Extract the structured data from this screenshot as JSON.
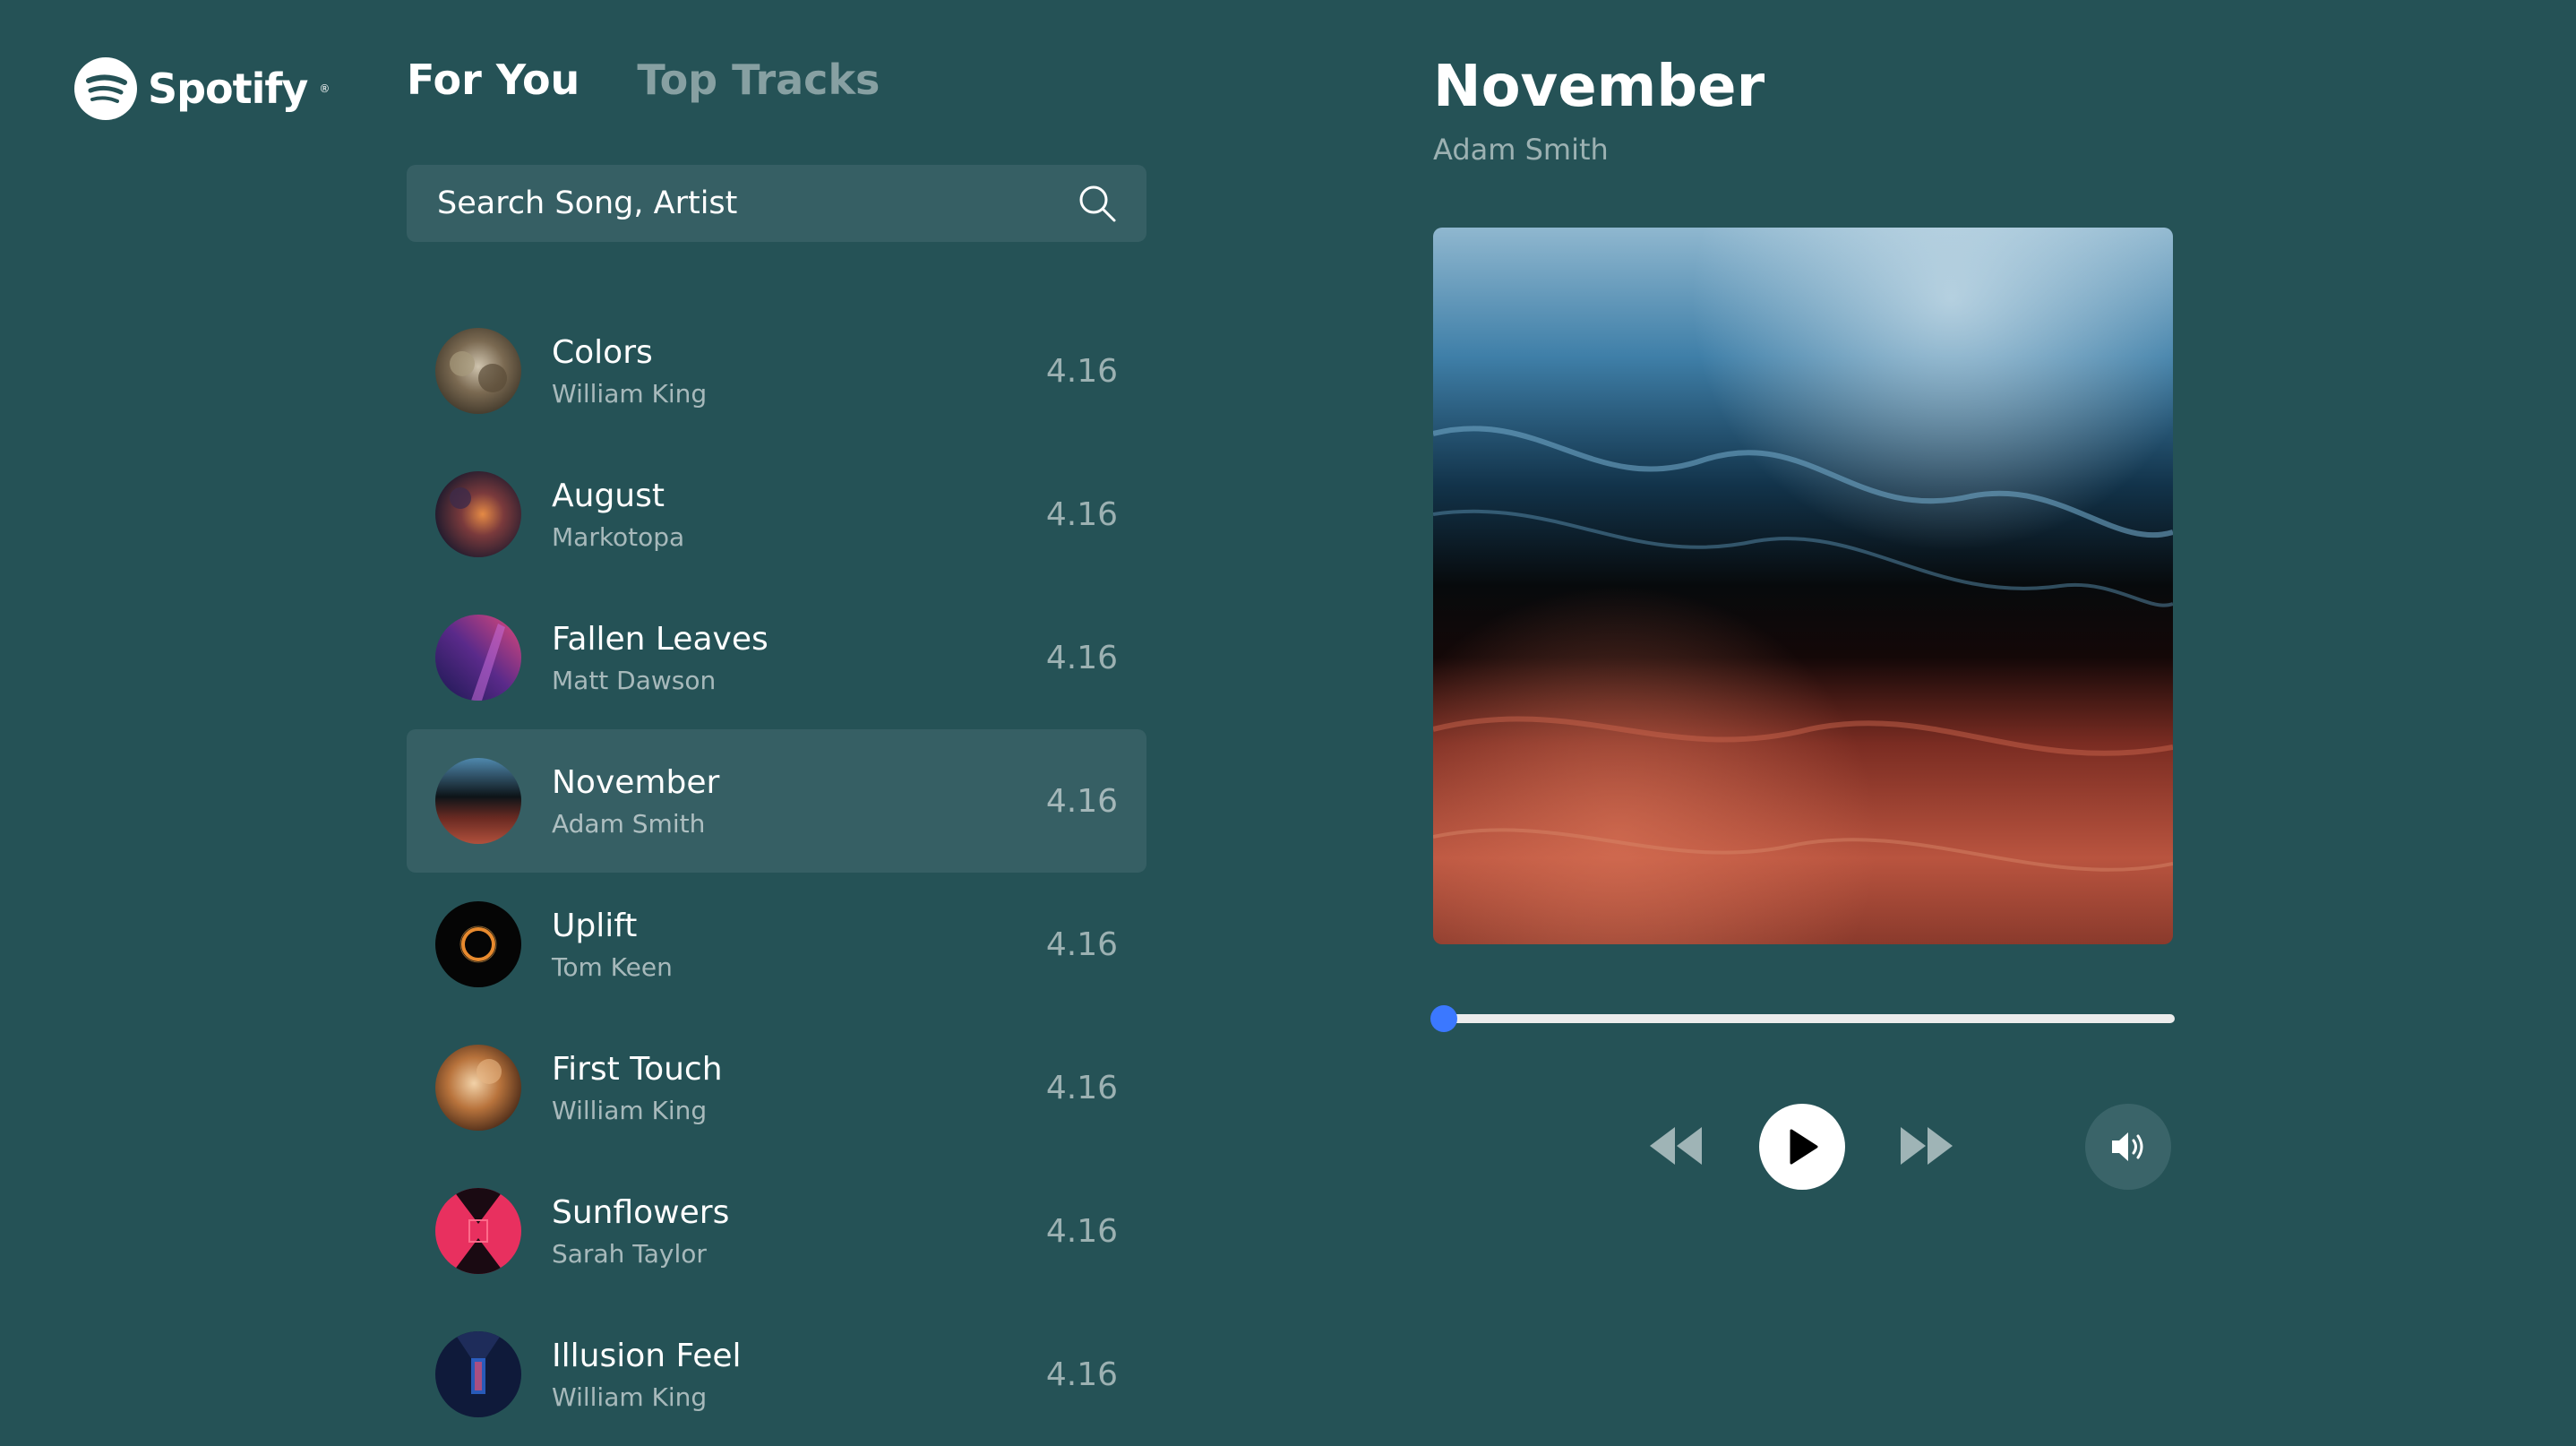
{
  "brand": {
    "name": "Spotify"
  },
  "tabs": [
    {
      "label": "For You",
      "active": true
    },
    {
      "label": "Top Tracks",
      "active": false
    }
  ],
  "search": {
    "placeholder": "Search Song, Artist"
  },
  "tracks": [
    {
      "title": "Colors",
      "artist": "William King",
      "duration": "4.16"
    },
    {
      "title": "August",
      "artist": "Markotopa",
      "duration": "4.16"
    },
    {
      "title": "Fallen Leaves",
      "artist": "Matt Dawson",
      "duration": "4.16"
    },
    {
      "title": "November",
      "artist": "Adam Smith",
      "duration": "4.16",
      "selected": true
    },
    {
      "title": "Uplift",
      "artist": "Tom Keen",
      "duration": "4.16"
    },
    {
      "title": "First Touch",
      "artist": "William King",
      "duration": "4.16"
    },
    {
      "title": "Sunflowers",
      "artist": "Sarah Taylor",
      "duration": "4.16"
    },
    {
      "title": "Illusion Feel",
      "artist": "William King",
      "duration": "4.16"
    }
  ],
  "now_playing": {
    "title": "November",
    "artist": "Adam Smith",
    "progress": 0.01
  },
  "controls": {
    "rewind_icon": "rewind-icon",
    "play_icon": "play-icon",
    "forward_icon": "fast-forward-icon",
    "volume_icon": "volume-icon"
  },
  "colors": {
    "background": "#255256",
    "panel": "#365f64",
    "accent": "#3b78ff"
  }
}
